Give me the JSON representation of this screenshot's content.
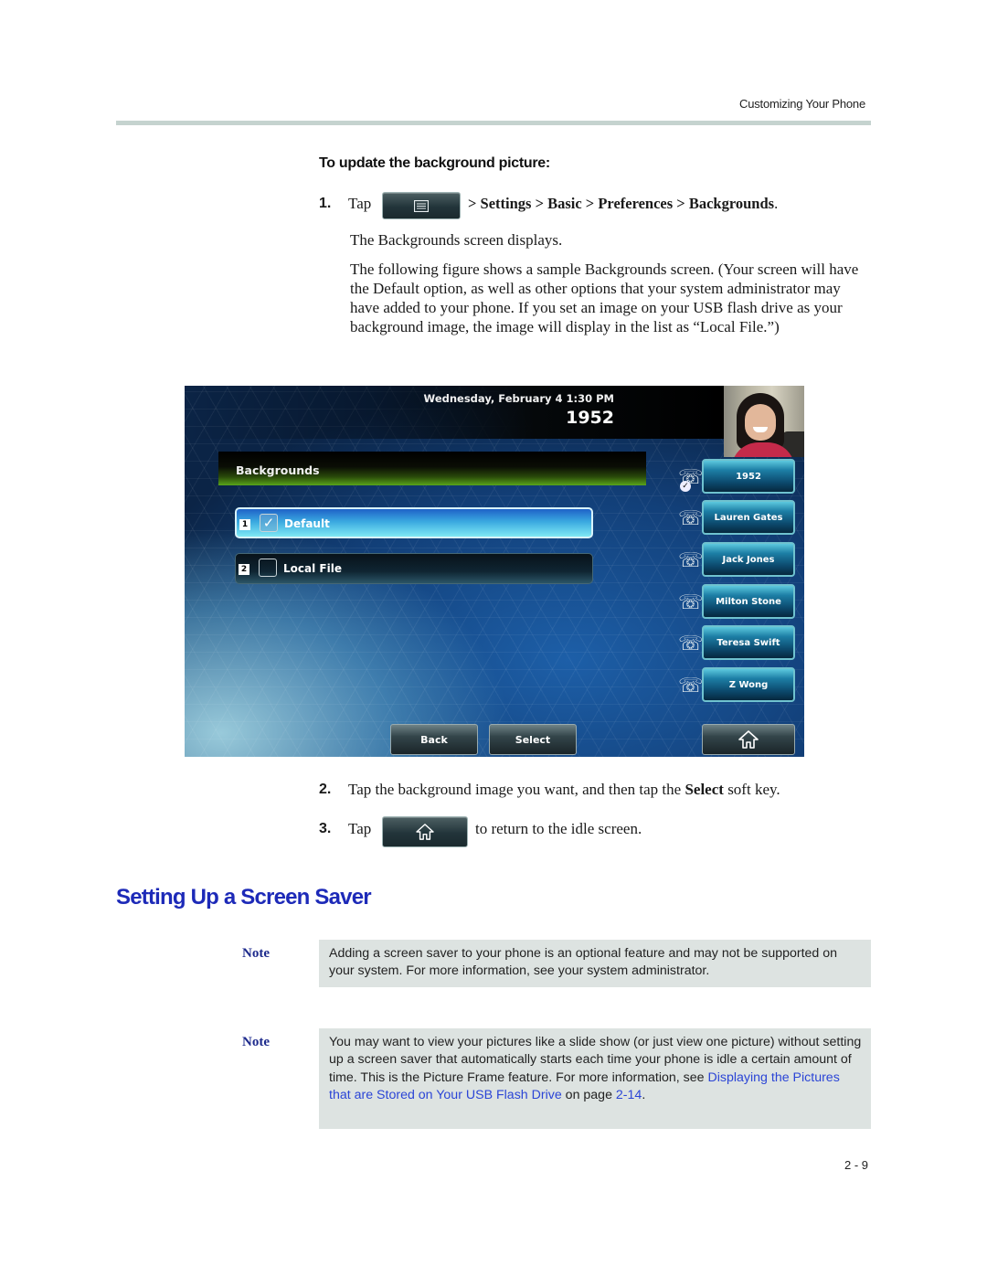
{
  "running_header": "Customizing Your Phone",
  "procedure_title": "To update the background picture:",
  "steps": [
    {
      "number": "1.",
      "prefix": "Tap",
      "key_icon": "menu-icon",
      "path": "> Settings > Basic > Preferences > Backgrounds",
      "suffix": ".",
      "result": "The Backgrounds screen displays.",
      "detail": "The following figure shows a sample Backgrounds screen. (Your screen will have the Default option, as well as other options that your system administrator may have added to your phone. If you set an image on your USB flash drive as your background image, the image will display in the list as “Local File.”)"
    },
    {
      "number": "2.",
      "text_before": "Tap the background image you want, and then tap the ",
      "bold": "Select",
      "text_after": " soft key."
    },
    {
      "number": "3.",
      "prefix": "Tap",
      "key_icon": "home-icon",
      "suffix": "to return to the idle screen."
    }
  ],
  "phone_screen": {
    "datetime": "Wednesday, February 4  1:30 PM",
    "extension": "1952",
    "menu_title": "Backgrounds",
    "list": [
      {
        "index": "1",
        "label": "Default",
        "checked": true,
        "selected": true
      },
      {
        "index": "2",
        "label": "Local File",
        "checked": false,
        "selected": false
      }
    ],
    "line_keys": [
      {
        "label": "1952",
        "icon": "phone-registered-icon"
      },
      {
        "label": "Lauren Gates",
        "icon": "speed-dial-icon"
      },
      {
        "label": "Jack Jones",
        "icon": "speed-dial-icon"
      },
      {
        "label": "Milton Stone",
        "icon": "speed-dial-icon"
      },
      {
        "label": "Teresa Swift",
        "icon": "speed-dial-icon"
      },
      {
        "label": "Z Wong",
        "icon": "speed-dial-icon"
      }
    ],
    "softkeys": {
      "back": "Back",
      "select": "Select",
      "home_icon": "home-icon"
    },
    "check_glyph": "✓",
    "colors": {
      "menu_header_green": "#58a51a",
      "selected_item": "#3aa8e0",
      "line_key": "#1d7fa6"
    }
  },
  "section_heading": "Setting Up a Screen Saver",
  "notes": [
    {
      "label": "Note",
      "text": "Adding a screen saver to your phone is an optional feature and may not be supported on your system. For more information, see your system administrator."
    },
    {
      "label": "Note",
      "text_before": "You may want to view your pictures like a slide show (or just view one picture) without setting up a screen saver that automatically starts each time your phone is idle a certain amount of time. This is the Picture Frame feature. For more information, see ",
      "link_text": "Displaying the Pictures that are Stored on Your USB Flash Drive",
      "text_middle": " on page ",
      "page_link": "2-14",
      "text_after": "."
    }
  ],
  "colors": {
    "heading_blue": "#1d2ab8",
    "link_blue": "#2b45d6",
    "note_bg": "#dde3e1",
    "rule": "#c5d3cf"
  },
  "page_number": "2 - 9"
}
